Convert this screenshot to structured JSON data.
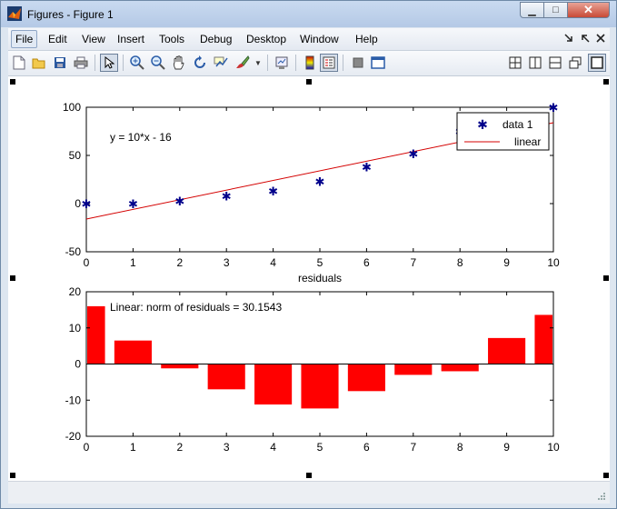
{
  "window": {
    "title": "Figures - Figure 1",
    "close_glyph": "✕",
    "min_glyph": "▁",
    "max_glyph": "□"
  },
  "menu": [
    "File",
    "Edit",
    "View",
    "Insert",
    "Tools",
    "Debug",
    "Desktop",
    "Window",
    "Help"
  ],
  "menu_right_icons": [
    "undock-icon",
    "dock-icon",
    "close-figure-icon"
  ],
  "toolbar": [
    "new-figure-icon",
    "open-icon",
    "save-icon",
    "print-icon",
    "pointer-icon",
    "zoom-in-icon",
    "zoom-out-icon",
    "pan-icon",
    "rotate-icon",
    "data-cursor-icon",
    "brush-icon",
    "link-plot-icon",
    "colorbar-icon",
    "legend-icon",
    "hide-plot-tools-icon",
    "show-plot-tools-icon",
    "tile-icon",
    "left-right-icon",
    "top-bottom-icon",
    "floating-icon",
    "maximize-icon"
  ],
  "colors": {
    "marker": "#00008b",
    "fit_line": "#d40000",
    "bar": "#ff0000"
  },
  "chart_data": [
    {
      "type": "scatter",
      "xlabel": "residuals",
      "ylabel": "",
      "title": "",
      "xlim": [
        0,
        10
      ],
      "ylim": [
        -50,
        100
      ],
      "xticks": [
        "0",
        "1",
        "2",
        "3",
        "4",
        "5",
        "6",
        "7",
        "8",
        "9",
        "10"
      ],
      "yticks": [
        "100",
        "50",
        "0",
        "-50"
      ],
      "annotation": "y = 10*x - 16",
      "legend": {
        "entries": [
          "data 1",
          "linear"
        ],
        "placement": "top-right"
      },
      "series": [
        {
          "name": "data 1",
          "x": [
            0,
            1,
            2,
            3,
            4,
            5,
            6,
            7,
            8,
            9,
            10
          ],
          "y": [
            0,
            0,
            3,
            8,
            13,
            23,
            38,
            52,
            75,
            80,
            100
          ]
        },
        {
          "name": "linear",
          "type": "line",
          "x": [
            0,
            10
          ],
          "y": [
            -16,
            84
          ]
        }
      ]
    },
    {
      "type": "bar",
      "title": "",
      "xlim": [
        0,
        10
      ],
      "ylim": [
        -20,
        20
      ],
      "xticks": [
        "0",
        "1",
        "2",
        "3",
        "4",
        "5",
        "6",
        "7",
        "8",
        "9",
        "10"
      ],
      "yticks": [
        "20",
        "10",
        "0",
        "-10",
        "-20"
      ],
      "annotation": "Linear: norm of residuals = 30.1543",
      "x": [
        0,
        1,
        2,
        3,
        4,
        5,
        6,
        7,
        8,
        9,
        10
      ],
      "values": [
        16,
        6.5,
        -1.2,
        -7,
        -11.2,
        -12.3,
        -7.5,
        -3,
        -2,
        7.2,
        13.6
      ]
    }
  ]
}
